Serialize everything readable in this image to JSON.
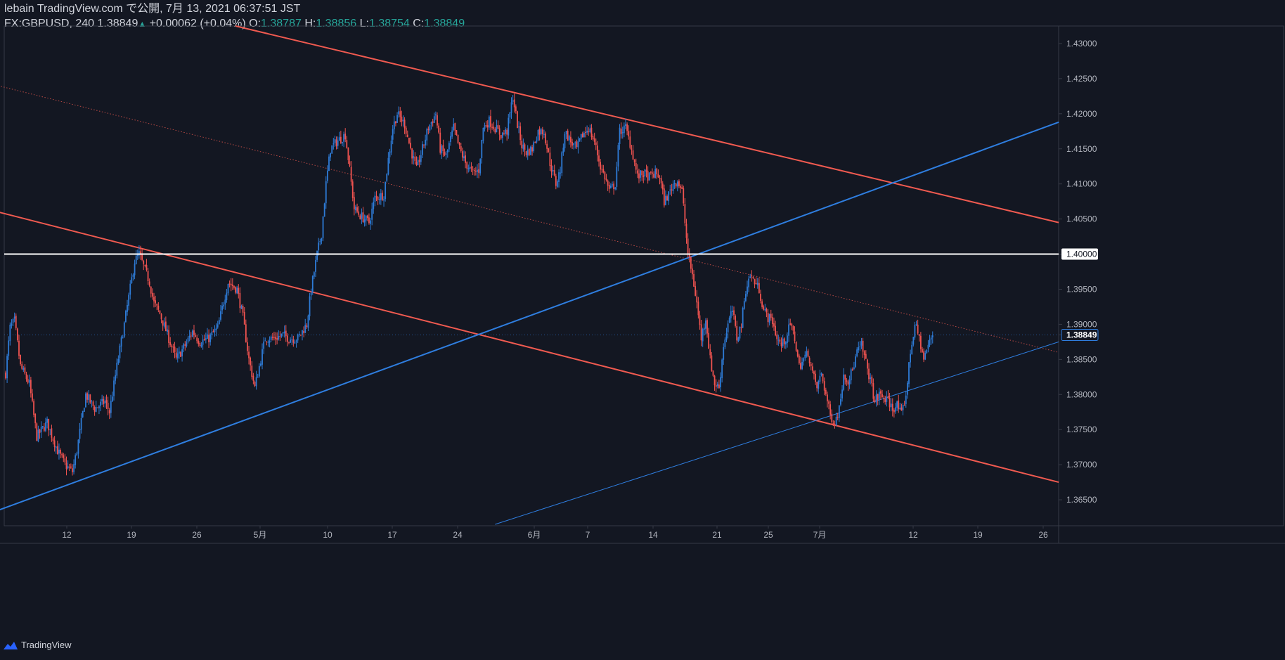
{
  "header": {
    "publish_line": "lebain TradingView.com で公開, 7月 13, 2021 06:37:51 JST",
    "symbol": "FX:GBPUSD, 240",
    "last": "1.38849",
    "arrow": "▲",
    "change": "+0.00062 (+0.04%)",
    "o_label": "O:",
    "o_val": "1.38787",
    "h_label": "H:",
    "h_val": "1.38856",
    "l_label": "L:",
    "l_val": "1.38754",
    "c_label": "C:",
    "c_val": "1.38849"
  },
  "footer": {
    "brand": "TradingView",
    "logo_icon": "tradingview-logo-icon"
  },
  "colors": {
    "background": "#131722",
    "up": "#2e7bd6",
    "down": "#ef5350",
    "trend_red": "#f05a50",
    "trend_blue": "#2f7ee0",
    "level_white": "#ffffff",
    "axis_text": "#b2b5be",
    "grid_border": "#363a45"
  },
  "chart_data": {
    "type": "candlestick",
    "symbol": "FX:GBPUSD",
    "timeframe": "240",
    "x_tick_labels": [
      "12",
      "19",
      "26",
      "5月",
      "10",
      "17",
      "24",
      "6月",
      "7",
      "14",
      "21",
      "25",
      "7月",
      "12",
      "19",
      "26"
    ],
    "y_tick_labels": [
      "1.43000",
      "1.42500",
      "1.42000",
      "1.41500",
      "1.41000",
      "1.40500",
      "1.40000",
      "1.39500",
      "1.39000",
      "1.38849",
      "1.38500",
      "1.38000",
      "1.37500",
      "1.37000",
      "1.36500"
    ],
    "ylim": [
      1.3613,
      1.4325
    ],
    "last_price": 1.38849,
    "horizontal_level": 1.4,
    "path_closes": [
      [
        0,
        1.383
      ],
      [
        3,
        1.3895
      ],
      [
        6,
        1.3905
      ],
      [
        10,
        1.384
      ],
      [
        16,
        1.3815
      ],
      [
        21,
        1.374
      ],
      [
        28,
        1.376
      ],
      [
        35,
        1.372
      ],
      [
        40,
        1.37
      ],
      [
        45,
        1.369
      ],
      [
        48,
        1.372
      ],
      [
        54,
        1.38
      ],
      [
        60,
        1.378
      ],
      [
        67,
        1.379
      ],
      [
        70,
        1.3775
      ],
      [
        75,
        1.384
      ],
      [
        80,
        1.39
      ],
      [
        87,
        1.399
      ],
      [
        90,
        1.4
      ],
      [
        97,
        1.396
      ],
      [
        100,
        1.393
      ],
      [
        104,
        1.3915
      ],
      [
        110,
        1.388
      ],
      [
        115,
        1.385
      ],
      [
        121,
        1.387
      ],
      [
        126,
        1.389
      ],
      [
        131,
        1.3875
      ],
      [
        137,
        1.388
      ],
      [
        143,
        1.3895
      ],
      [
        150,
        1.396
      ],
      [
        156,
        1.395
      ],
      [
        160,
        1.391
      ],
      [
        164,
        1.385
      ],
      [
        168,
        1.381
      ],
      [
        175,
        1.388
      ],
      [
        181,
        1.388
      ],
      [
        187,
        1.3885
      ],
      [
        191,
        1.388
      ],
      [
        197,
        1.388
      ],
      [
        200,
        1.389
      ],
      [
        203,
        1.39
      ],
      [
        206,
        1.395
      ],
      [
        210,
        1.4
      ],
      [
        213,
        1.403
      ],
      [
        216,
        1.41
      ],
      [
        219,
        1.415
      ],
      [
        223,
        1.416
      ],
      [
        229,
        1.417
      ],
      [
        232,
        1.412
      ],
      [
        235,
        1.4065
      ],
      [
        239,
        1.4055
      ],
      [
        245,
        1.4045
      ],
      [
        249,
        1.408
      ],
      [
        255,
        1.4085
      ],
      [
        258,
        1.4135
      ],
      [
        261,
        1.418
      ],
      [
        264,
        1.42
      ],
      [
        269,
        1.4185
      ],
      [
        273,
        1.415
      ],
      [
        277,
        1.412
      ],
      [
        281,
        1.415
      ],
      [
        285,
        1.418
      ],
      [
        290,
        1.42
      ],
      [
        293,
        1.415
      ],
      [
        297,
        1.414
      ],
      [
        302,
        1.418
      ],
      [
        306,
        1.415
      ],
      [
        310,
        1.413
      ],
      [
        315,
        1.4115
      ],
      [
        319,
        1.412
      ],
      [
        322,
        1.418
      ],
      [
        326,
        1.419
      ],
      [
        330,
        1.418
      ],
      [
        334,
        1.417
      ],
      [
        338,
        1.4175
      ],
      [
        342,
        1.4225
      ],
      [
        345,
        1.4185
      ],
      [
        348,
        1.4155
      ],
      [
        351,
        1.4145
      ],
      [
        355,
        1.415
      ],
      [
        359,
        1.4175
      ],
      [
        363,
        1.4175
      ],
      [
        367,
        1.413
      ],
      [
        371,
        1.41
      ],
      [
        374,
        1.412
      ],
      [
        377,
        1.4175
      ],
      [
        381,
        1.416
      ],
      [
        385,
        1.415
      ],
      [
        389,
        1.417
      ],
      [
        393,
        1.418
      ],
      [
        397,
        1.416
      ],
      [
        401,
        1.4125
      ],
      [
        404,
        1.411
      ],
      [
        407,
        1.409
      ],
      [
        411,
        1.41
      ],
      [
        414,
        1.4175
      ],
      [
        418,
        1.418
      ],
      [
        422,
        1.415
      ],
      [
        426,
        1.411
      ],
      [
        430,
        1.4115
      ],
      [
        434,
        1.411
      ],
      [
        438,
        1.4115
      ],
      [
        441,
        1.411
      ],
      [
        444,
        1.4075
      ],
      [
        447,
        1.4085
      ],
      [
        450,
        1.41
      ],
      [
        453,
        1.4105
      ],
      [
        456,
        1.409
      ],
      [
        460,
        1.4
      ],
      [
        463,
        1.397
      ],
      [
        466,
        1.393
      ],
      [
        469,
        1.388
      ],
      [
        472,
        1.391
      ],
      [
        475,
        1.385
      ],
      [
        478,
        1.3815
      ],
      [
        481,
        1.381
      ],
      [
        484,
        1.387
      ],
      [
        487,
        1.39
      ],
      [
        490,
        1.392
      ],
      [
        493,
        1.388
      ],
      [
        496,
        1.39
      ],
      [
        499,
        1.395
      ],
      [
        502,
        1.397
      ],
      [
        505,
        1.396
      ],
      [
        508,
        1.395
      ],
      [
        511,
        1.392
      ],
      [
        514,
        1.391
      ],
      [
        517,
        1.3905
      ],
      [
        520,
        1.388
      ],
      [
        523,
        1.387
      ],
      [
        526,
        1.388
      ],
      [
        529,
        1.39
      ],
      [
        532,
        1.388
      ],
      [
        535,
        1.384
      ],
      [
        538,
        1.385
      ],
      [
        541,
        1.386
      ],
      [
        544,
        1.383
      ],
      [
        547,
        1.381
      ],
      [
        550,
        1.383
      ],
      [
        553,
        1.38
      ],
      [
        556,
        1.377
      ],
      [
        559,
        1.376
      ],
      [
        562,
        1.378
      ],
      [
        565,
        1.383
      ],
      [
        568,
        1.382
      ],
      [
        571,
        1.3835
      ],
      [
        574,
        1.386
      ],
      [
        577,
        1.387
      ],
      [
        580,
        1.3845
      ],
      [
        583,
        1.382
      ],
      [
        586,
        1.379
      ],
      [
        589,
        1.38
      ],
      [
        592,
        1.3795
      ],
      [
        595,
        1.379
      ],
      [
        598,
        1.378
      ],
      [
        601,
        1.3785
      ],
      [
        604,
        1.377
      ],
      [
        607,
        1.38
      ],
      [
        610,
        1.386
      ],
      [
        613,
        1.39
      ],
      [
        616,
        1.388
      ],
      [
        619,
        1.385
      ],
      [
        622,
        1.387
      ],
      [
        625,
        1.3885
      ]
    ],
    "trendlines": [
      {
        "color_key": "trend_red",
        "style": "solid",
        "from": [
          -5,
          1.406
        ],
        "to": [
          710,
          1.3675
        ]
      },
      {
        "color_key": "trend_red",
        "style": "solid",
        "from": [
          155,
          1.4325
        ],
        "to": [
          710,
          1.4045
        ]
      },
      {
        "color_key": "trend_red",
        "style": "dotted",
        "from": [
          -5,
          1.424
        ],
        "to": [
          710,
          1.386
        ]
      },
      {
        "color_key": "trend_blue",
        "style": "solid",
        "from": [
          -5,
          1.3635
        ],
        "to": [
          710,
          1.4188
        ]
      },
      {
        "color_key": "trend_blue",
        "style": "solid-thin",
        "from": [
          330,
          1.3615
        ],
        "to": [
          710,
          1.3875
        ]
      }
    ]
  }
}
